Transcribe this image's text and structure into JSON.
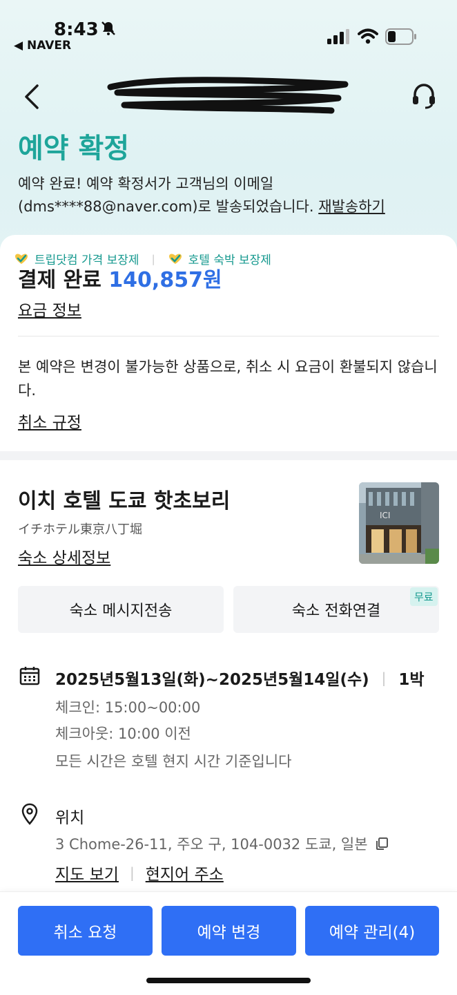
{
  "status_bar": {
    "time": "8:43",
    "back_app": "◀ NAVER"
  },
  "header": {
    "title_redacted": ""
  },
  "confirmation": {
    "title": "예약 확정",
    "message_line1": "예약 완료! 예약 확정서가 고객님의 이메일",
    "message_line2": "(dms****88@naver.com)로 발송되었습니다.",
    "resend_label": "재발송하기"
  },
  "badges": [
    {
      "label": "트립닷컴 가격 보장제"
    },
    {
      "label": "호텔 숙박 보장제"
    }
  ],
  "payment": {
    "label": "결제 완료",
    "amount": "140,857원",
    "fee_info_link": "요금 정보"
  },
  "policy": {
    "text": "본 예약은 변경이 불가능한 상품으로, 취소 시 요금이 환불되지 않습니다.",
    "link": "취소 규정"
  },
  "hotel": {
    "name": "이치 호텔 도쿄 핫초보리",
    "local_name": "イチホテル東京八丁堀",
    "detail_link": "숙소 상세정보",
    "message_button": "숙소 메시지전송",
    "call_button": "숙소 전화연결",
    "free_tag": "무료"
  },
  "stay": {
    "dates": "2025년5월13일(화)~2025년5월14일(수)",
    "nights": "1박",
    "checkin": "체크인: 15:00~00:00",
    "checkout": "체크아웃: 10:00 이전",
    "time_note": "모든 시간은 호텔 현지 시간 기준입니다"
  },
  "location": {
    "title": "위치",
    "address": "3 Chome-26-11, 주오 구, 104-0032 도쿄, 일본",
    "map_link": "지도 보기",
    "local_address_link": "현지어 주소"
  },
  "actions": {
    "cancel": "취소 요청",
    "change": "예약 변경",
    "manage": "예약 관리(4)"
  },
  "colors": {
    "accent_teal": "#1ea59a",
    "primary_blue": "#2f6ff5",
    "amount_blue": "#2f6fe4"
  }
}
